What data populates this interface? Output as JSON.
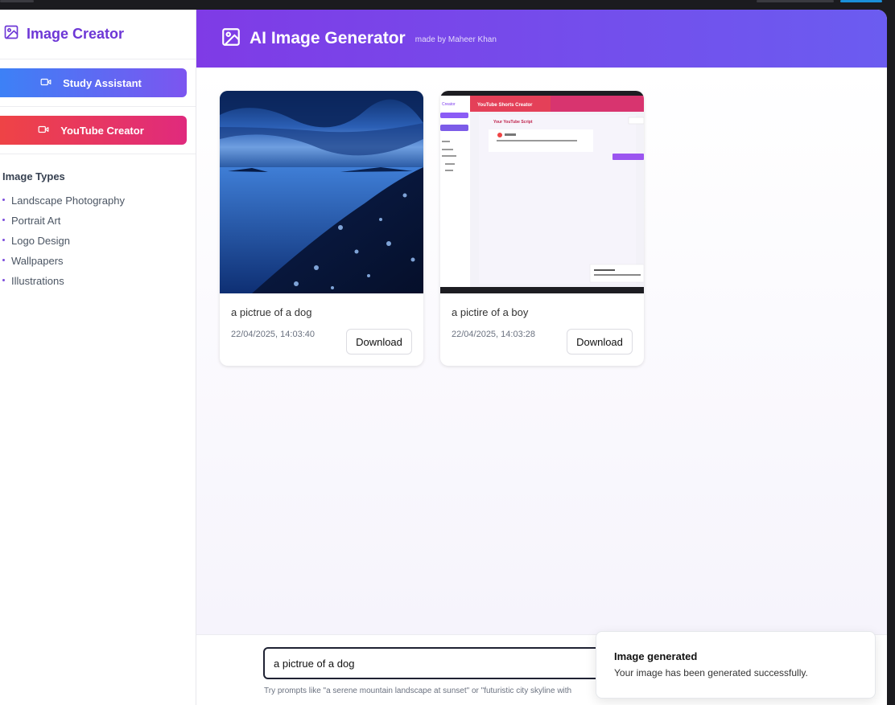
{
  "sidebar": {
    "brand": "Image Creator",
    "buttons": [
      {
        "label": "Study Assistant"
      },
      {
        "label": "YouTube Creator"
      }
    ],
    "types_title": "Image Types",
    "types": [
      "Landscape Photography",
      "Portrait Art",
      "Logo Design",
      "Wallpapers",
      "Illustrations"
    ]
  },
  "header": {
    "title": "AI Image Generator",
    "subtitle": "made by Maheer Khan"
  },
  "gallery": [
    {
      "prompt": "a pictrue of a dog",
      "date": "22/04/2025, 14:03:40",
      "download_label": "Download"
    },
    {
      "prompt": "a pictire of a boy",
      "date": "22/04/2025, 14:03:28",
      "download_label": "Download"
    }
  ],
  "thumb2": {
    "brand": "Creator",
    "header": "YouTube Shorts Creator",
    "panel_title": "Your YouTube Script"
  },
  "input": {
    "value": "a pictrue of a dog",
    "hint": "Try prompts like \"a serene mountain landscape at sunset\" or \"futuristic city skyline with"
  },
  "toast": {
    "title": "Image generated",
    "description": "Your image has been generated successfully."
  },
  "colors": {
    "brand_purple": "#6d37d6",
    "header_start": "#7f3be6",
    "header_end": "#6b5cf0"
  }
}
